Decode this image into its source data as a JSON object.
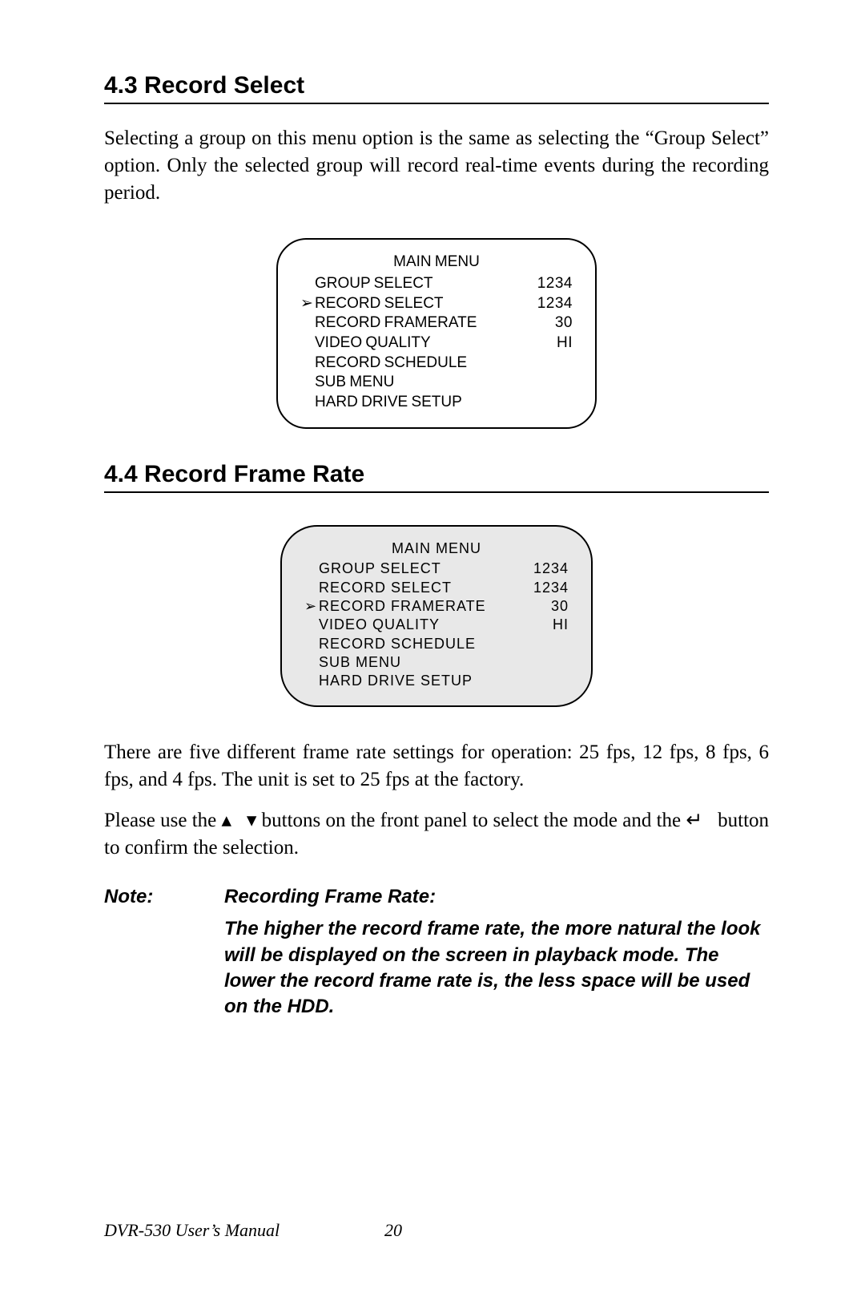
{
  "section43": {
    "heading": "4.3  Record Select",
    "para": "Selecting a group on this menu option is the same as selecting the “Group Select” option. Only the selected group will record real-time events during the recording period.",
    "menu": {
      "title": "MAIN MENU",
      "rows": [
        {
          "cursor": "",
          "label": "GROUP  SELECT",
          "val": "1234"
        },
        {
          "cursor": "➢",
          "label": "RECORD SELECT",
          "val": "1234"
        },
        {
          "cursor": "",
          "label": "RECORD FRAMERATE",
          "val": "30"
        },
        {
          "cursor": "",
          "label": "VIDEO QUALITY",
          "val": "HI"
        },
        {
          "cursor": "",
          "label": "RECORD SCHEDULE",
          "val": ""
        },
        {
          "cursor": "",
          "label": "SUB MENU",
          "val": ""
        },
        {
          "cursor": "",
          "label": "HARD DRIVE SETUP",
          "val": ""
        }
      ]
    }
  },
  "section44": {
    "heading": "4.4  Record Frame Rate",
    "menu": {
      "title": "MAIN MENU",
      "rows": [
        {
          "cursor": "",
          "label": "GROUP  SELECT",
          "val": "1234"
        },
        {
          "cursor": "",
          "label": "RECORD SELECT",
          "val": "1234"
        },
        {
          "cursor": "➢",
          "label": "RECORD FRAMERATE",
          "val": "30"
        },
        {
          "cursor": "",
          "label": "VIDEO QUALITY",
          "val": "HI"
        },
        {
          "cursor": "",
          "label": "RECORD SCHEDULE",
          "val": ""
        },
        {
          "cursor": "",
          "label": "SUB MENU",
          "val": ""
        },
        {
          "cursor": "",
          "label": "HARD DRIVE SETUP",
          "val": ""
        }
      ]
    },
    "para1": "There are five different frame rate settings for operation: 25 fps, 12 fps, 8 fps, 6 fps, and 4 fps. The unit is set to 25 fps at the factory.",
    "para2_pre": "Please use the ",
    "para2_mid": " buttons on the front panel to select the mode and the ",
    "para2_post": " button to confirm the selection.",
    "glyph_up": "▴",
    "glyph_down": "▾",
    "glyph_enter": "↵",
    "note_label": "Note:",
    "note_title": "Recording Frame Rate:",
    "note_body": "The higher the record frame rate, the more natural the look will be displayed on the screen in playback mode. The lower the record frame rate is, the less space will be used on the HDD."
  },
  "footer": {
    "doc": "DVR-530 User’s Manual",
    "page": "20"
  }
}
